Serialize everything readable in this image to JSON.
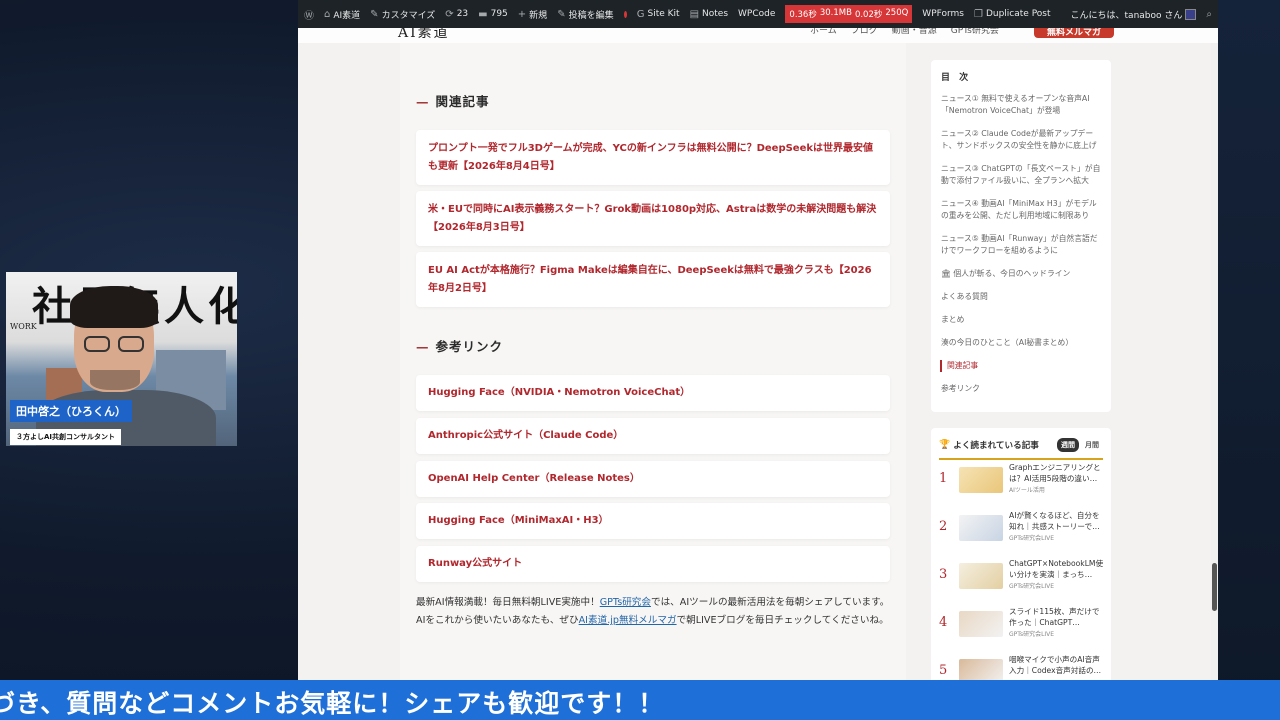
{
  "adminbar": {
    "site_name": "AI素道",
    "customize": "カスタマイズ",
    "updates": "23",
    "comments": "795",
    "new": "新規",
    "edit": "投稿を編集",
    "sitekit": "Site Kit",
    "notes": "Notes",
    "wpcode": "WPCode",
    "perf": [
      "0.36秒",
      "30.1MB",
      "0.02秒",
      "250Q"
    ],
    "wpforms": "WPForms",
    "duplicate": "Duplicate Post",
    "greeting": "こんにちは、tanaboo さん"
  },
  "site_header": {
    "logo": "AI素道",
    "nav": [
      "ホーム",
      "ブログ",
      "動画・音源",
      "GPTs研究会"
    ],
    "mail_button": "無料メルマガ"
  },
  "related": {
    "heading": "関連記事",
    "items": [
      "プロンプト一発でフル3Dゲームが完成、YCの新インフラは無料公開に？DeepSeekは世界最安値も更新【2026年8月4日号】",
      "米・EUで同時にAI表示義務スタート？Grok動画は1080p対応、Astraは数学の未解決問題も解決【2026年8月3日号】",
      "EU AI Actが本格施行？Figma Makeは編集自在に、DeepSeekは無料で最強クラスも【2026年8月2日号】"
    ]
  },
  "refs": {
    "heading": "参考リンク",
    "items": [
      "Hugging Face（NVIDIA・Nemotron VoiceChat）",
      "Anthropic公式サイト（Claude Code）",
      "OpenAI Help Center（Release Notes）",
      "Hugging Face（MiniMaxAI・H3）",
      "Runway公式サイト"
    ]
  },
  "promo": {
    "p1": "最新AI情報満載！毎日無料朝LIVE実施中！",
    "link1": "GPTs研究会",
    "p2": "では、AIツールの最新活用法を毎朝シェアしています。AIをこれから使いたいあなたも、ぜひ",
    "link2": "AI素道.jp無料メルマガ",
    "p3": "で朝LIVEブログを毎日チェックしてくださいね。"
  },
  "toc": {
    "heading": "目 次",
    "items": [
      "ニュース① 無料で使えるオープンな音声AI「Nemotron VoiceChat」が登場",
      "ニュース② Claude Codeが最新アップデート、サンドボックスの安全性を静かに底上げ",
      "ニュース③ ChatGPTの「長文ペースト」が自動で添付ファイル扱いに、全プランへ拡大",
      "ニュース④ 動画AI「MiniMax H3」がモデルの重みを公開、ただし利用地域に制限あり",
      "ニュース⑤ 動画AI「Runway」が自然言語だけでワークフローを組めるように",
      "🏛 個人が斬る、今日のヘッドライン",
      "よくある質問",
      "まとめ",
      "湊の今日のひとこと（AI秘書まとめ）",
      "関連記事",
      "参考リンク"
    ],
    "active_index": 9
  },
  "popular": {
    "heading": "よく読まれている記事",
    "tabs": [
      "週間",
      "月間"
    ],
    "items": [
      {
        "rank": "1",
        "title": "Graphエンジニアリングとは？AI活用5段階の違い…",
        "cat": "AIツール活用"
      },
      {
        "rank": "2",
        "title": "AIが賢くなるほど、自分を知れ｜共感ストーリーで…",
        "cat": "GPTs研究会LIVE"
      },
      {
        "rank": "3",
        "title": "ChatGPT×NotebookLM使い分けを実演｜まっち…",
        "cat": "GPTs研究会LIVE"
      },
      {
        "rank": "4",
        "title": "スライド115枚、声だけで作った｜ChatGPT…",
        "cat": "GPTs研究会LIVE"
      },
      {
        "rank": "5",
        "title": "咽喉マイクで小声のAI音声入力｜Codex音声対話の…",
        "cat": ""
      }
    ]
  },
  "webcam": {
    "name": "田中啓之（ひろくん）",
    "title": "３方よしAI共創コンサルタント",
    "board_text": "社員無人化",
    "work_text": "WORK"
  },
  "ticker": {
    "text": "づき、質問などコメントお気軽に！シェアも歓迎です！！"
  }
}
